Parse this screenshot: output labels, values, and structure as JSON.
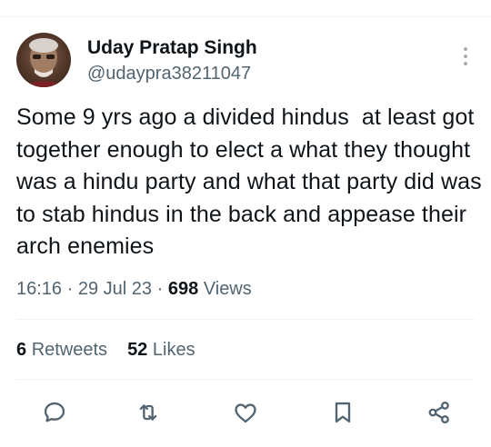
{
  "author": {
    "display_name": "Uday Pratap Singh",
    "handle": "@udaypra38211047",
    "avatar_icon": "user-avatar"
  },
  "tweet": {
    "text": "Some 9 yrs ago a divided hindus  at least got together enough to elect a what they thought was a hindu party and what that party did was to stab hindus in the back and appease their arch enemies",
    "time": "16:16",
    "date": "29 Jul 23",
    "separator": "·",
    "views_count": "698",
    "views_label": "Views"
  },
  "stats": {
    "retweets_count": "6",
    "retweets_label": "Retweets",
    "likes_count": "52",
    "likes_label": "Likes"
  },
  "actions": {
    "reply_icon": "reply-icon",
    "retweet_icon": "retweet-icon",
    "like_icon": "heart-icon",
    "bookmark_icon": "bookmark-icon",
    "share_icon": "share-icon"
  },
  "colors": {
    "text_primary": "#0f1419",
    "text_secondary": "#536471",
    "divider": "#eff3f4"
  }
}
